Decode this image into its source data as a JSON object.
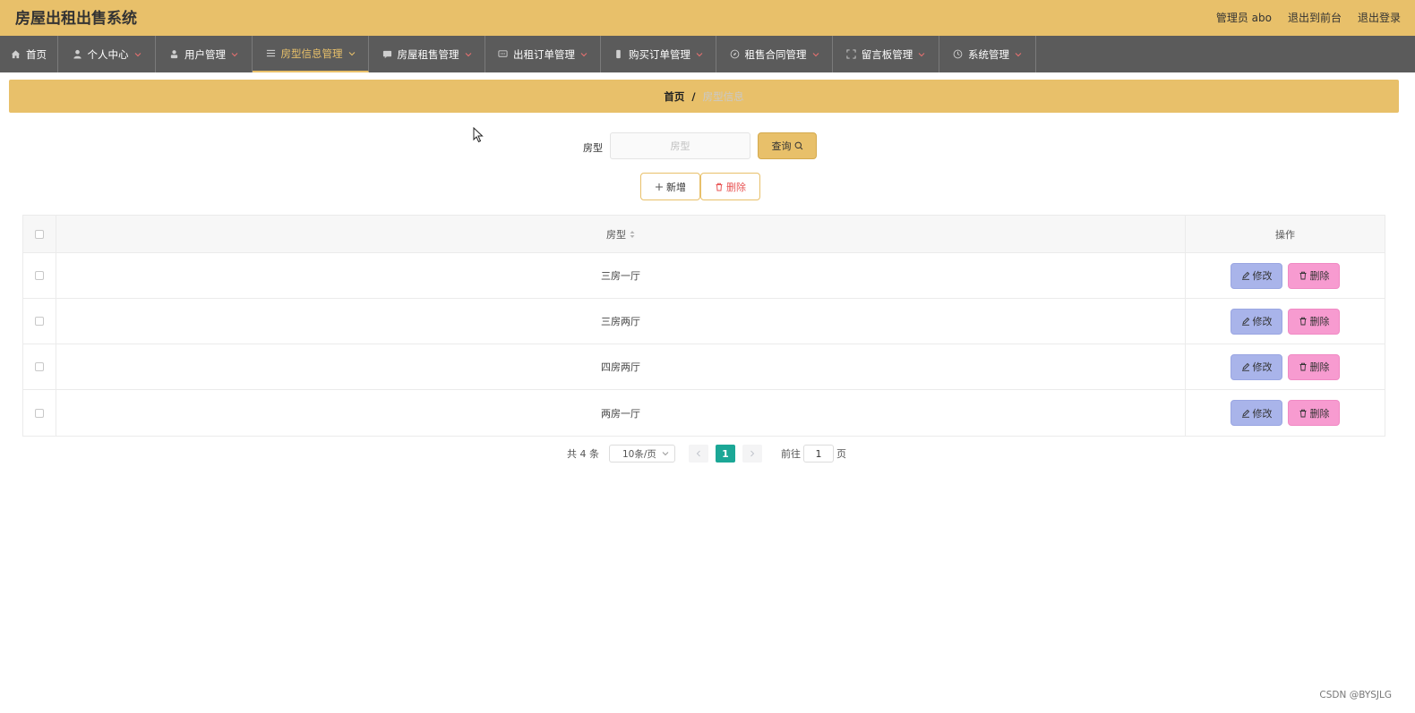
{
  "app": {
    "title": "房屋出租出售系统"
  },
  "topbar": {
    "user": "管理员 abo",
    "front": "退出到前台",
    "logout": "退出登录"
  },
  "nav": [
    {
      "label": "首页",
      "icon": "home-icon"
    },
    {
      "label": "个人中心",
      "icon": "user-icon"
    },
    {
      "label": "用户管理",
      "icon": "user-manage-icon"
    },
    {
      "label": "房型信息管理",
      "icon": "list-icon"
    },
    {
      "label": "房屋租售管理",
      "icon": "chat-icon"
    },
    {
      "label": "出租订单管理",
      "icon": "message-icon"
    },
    {
      "label": "购买订单管理",
      "icon": "phone-icon"
    },
    {
      "label": "租售合同管理",
      "icon": "compass-icon"
    },
    {
      "label": "留言板管理",
      "icon": "fullscreen-icon"
    },
    {
      "label": "系统管理",
      "icon": "clock-icon"
    }
  ],
  "breadcrumb": {
    "home": "首页",
    "sep": "/",
    "current": "房型信息"
  },
  "search": {
    "label": "房型",
    "placeholder": "房型",
    "value": "",
    "button": "查询"
  },
  "actions": {
    "add": "新增",
    "delete": "删除"
  },
  "table": {
    "headers": {
      "type": "房型",
      "ops": "操作"
    },
    "rows": [
      {
        "type": "三房一厅"
      },
      {
        "type": "三房两厅"
      },
      {
        "type": "四房两厅"
      },
      {
        "type": "两房一厅"
      }
    ],
    "edit_label": "修改",
    "delete_label": "删除"
  },
  "pager": {
    "total": "共 4 条",
    "size": "10条/页",
    "current": "1",
    "goto": "前往",
    "goto_value": "1",
    "unit": "页"
  },
  "watermark": "CSDN @BYSJLG",
  "colors": {
    "accent": "#e8c06a",
    "nav": "#5b5b5b",
    "edit": "#a9b4ea",
    "remove": "#f79bd0",
    "page": "#1ba796"
  }
}
